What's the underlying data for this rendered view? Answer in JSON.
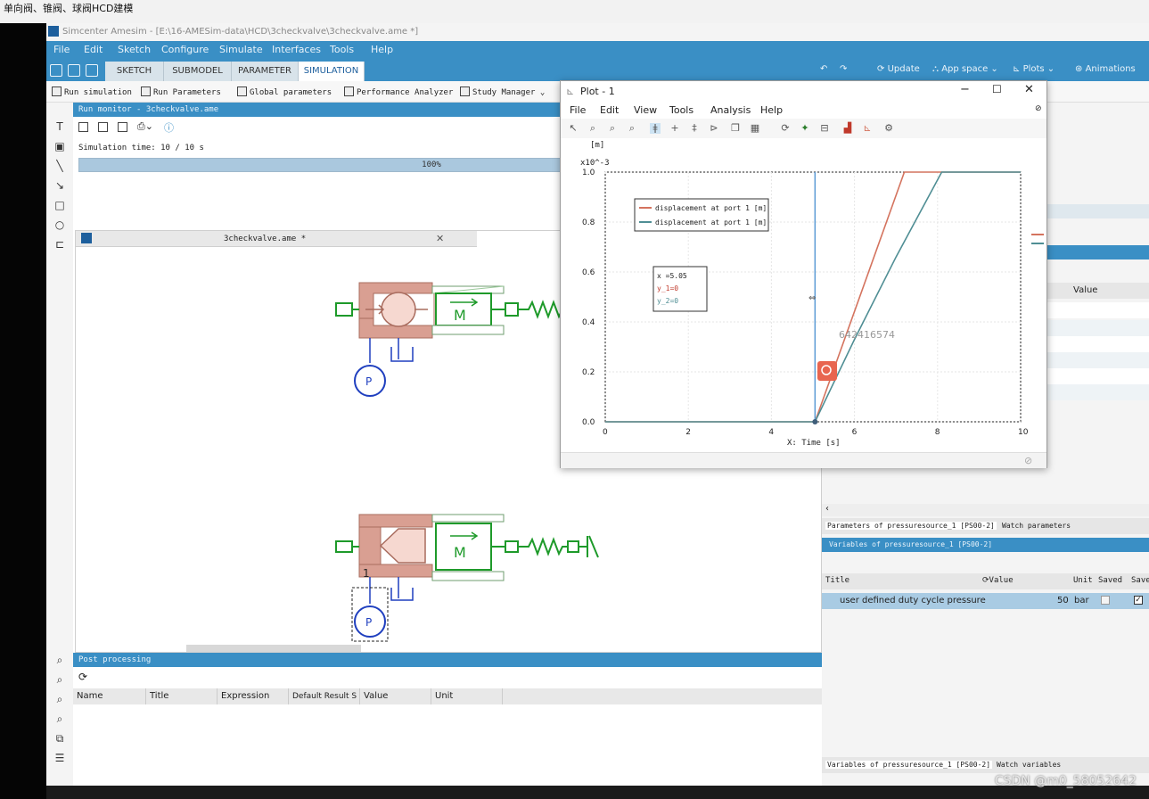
{
  "caption": {
    "text": "单向阀、锥阀、球阀HCD建模"
  },
  "app": {
    "title": "Simcenter Amesim - [E:\\16-AMESim-data\\HCD\\3checkvalve\\3checkvalve.ame *]",
    "menu": [
      "File",
      "Edit",
      "Sketch",
      "Configure",
      "Simulate",
      "Interfaces",
      "Tools",
      "Help"
    ],
    "ribbon_tabs": [
      "SKETCH",
      "SUBMODEL",
      "PARAMETER",
      "SIMULATION"
    ],
    "ribbon_right": {
      "update": "Update",
      "app_space": "App space",
      "plots": "Plots",
      "animations": "Animations"
    }
  },
  "toolbar2": [
    "Run simulation",
    "Run Parameters",
    "Global parameters",
    "Performance Analyzer",
    "Study Manager"
  ],
  "run_monitor": {
    "title": "Run monitor - 3checkvalve.ame",
    "sim_time": "Simulation time: 10 / 10 s",
    "progress_label": "100%",
    "progress_value": 1.0
  },
  "sketch": {
    "tab_title": "3checkvalve.ame *",
    "p_label": "P",
    "m_label": "M",
    "port_label": "1"
  },
  "right_panel": {
    "value_header": "Value",
    "tabs_top": [
      "Parameters of pressuresource_1 [PS00-2]",
      "Watch parameters"
    ],
    "variables_bar": "Variables of pressuresource_1 [PS00-2]",
    "headers": [
      "Title",
      "Value",
      "Unit",
      "Saved",
      "Save"
    ],
    "row": {
      "title": "user defined duty cycle pressure",
      "value": "50",
      "unit": "bar"
    },
    "tabs_bottom": [
      "Variables of pressuresource_1 [PS00-2]",
      "Watch variables"
    ]
  },
  "post_processing": {
    "title": "Post processing",
    "headers": [
      "Name",
      "Title",
      "Expression",
      "Default Result S",
      "Value",
      "Unit"
    ]
  },
  "plot": {
    "window_title": "Plot - 1",
    "menu": [
      "File",
      "Edit",
      "View",
      "Tools",
      "Analysis",
      "Help"
    ],
    "cursor_box": {
      "x": "x  =5.05",
      "y1": "y_1=0",
      "y2": "y_2=0"
    },
    "watermark_id": "642416574"
  },
  "chart_data": {
    "type": "line",
    "title": "",
    "xlabel": "X: Time [s]",
    "ylabel": "[m]",
    "y_multiplier": "x10^-3",
    "xlim": [
      0,
      10
    ],
    "ylim": [
      0,
      1.0
    ],
    "xticks": [
      0,
      2,
      4,
      6,
      8,
      10
    ],
    "yticks": [
      0.0,
      0.2,
      0.4,
      0.6,
      0.8,
      1.0
    ],
    "grid": true,
    "legend_position": "top-left",
    "cursor_x": 5.05,
    "series": [
      {
        "name": "displacement at port 1 [m]",
        "color": "#d4735e",
        "x": [
          0,
          5.05,
          7.2,
          10
        ],
        "y": [
          0,
          0,
          1.0,
          1.0
        ]
      },
      {
        "name": "displacement at port 1 [m]",
        "color": "#4f8e94",
        "x": [
          0,
          5.05,
          6.0,
          7.0,
          8.1,
          10
        ],
        "y": [
          0,
          0,
          0.33,
          0.66,
          1.0,
          1.0
        ]
      }
    ]
  },
  "watermark": "CSDN @m0_58052642",
  "colors": {
    "accent": "#3a8fc5",
    "hydraulic": "#c98b7e",
    "mechanical": "#1e9a2a",
    "signal": "#1f3fbf"
  }
}
